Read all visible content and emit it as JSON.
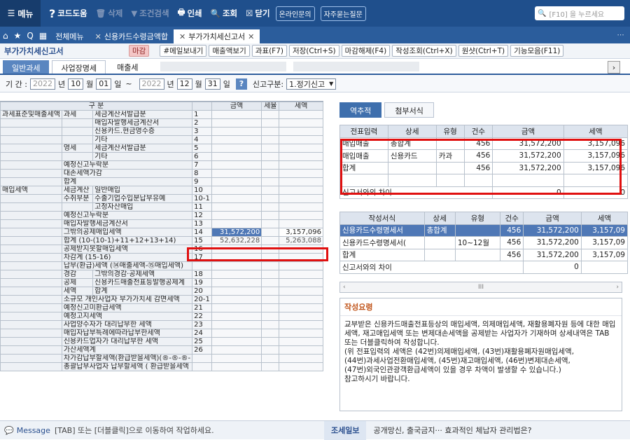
{
  "toolbar": {
    "menu": "메뉴",
    "help": "코드도움",
    "delete": "삭제",
    "condsearch": "조건검색",
    "print": "인쇄",
    "query": "조회",
    "close": "닫기",
    "online": "온라인문의",
    "faq": "자주묻는질문",
    "search_placeholder": "[F10] 을 누르세요"
  },
  "tabs": {
    "all": "전체메뉴",
    "t1": "신용카드수령금액합",
    "t2": "부가가치세신고서"
  },
  "page": {
    "title": "부가가치세신고서",
    "deadline": "마감",
    "buttons": [
      "#메일보내기",
      "매출액보기",
      "과표(F7)",
      "저장(Ctrl+S)",
      "마감해제(F4)",
      "작성조회(Ctrl+X)",
      "원샷(Ctrl+T)",
      "기능모음(F11)"
    ]
  },
  "subtabs": {
    "general": "일반과세",
    "biz": "사업장명세",
    "sales": "매출세"
  },
  "filter": {
    "period_label": "기 간 :",
    "y1": "2022",
    "y_unit": "년",
    "m1": "10",
    "m_unit": "월",
    "d1": "01",
    "d_unit": "일",
    "tilde": "~",
    "y2": "2022",
    "m2": "12",
    "d2": "31",
    "type_label": "신고구분:",
    "type_value": "1.정기신고"
  },
  "left": {
    "h_gubun": "구 분",
    "h_amt": "금액",
    "h_rate": "세율",
    "h_tax": "세액",
    "groups": {
      "g1": "과세표준및매출세액",
      "g2": "매입세액"
    },
    "rows": [
      {
        "a": "과세",
        "b": "세금계산서발급분",
        "no": "1"
      },
      {
        "a": "",
        "b": "매입자발행세금계산서",
        "no": "2"
      },
      {
        "a": "",
        "b": "신용카드.현금영수증",
        "no": "3"
      },
      {
        "a": "",
        "b": "기타",
        "no": "4"
      },
      {
        "a": "영세",
        "b": "세금계산서발급분",
        "no": "5"
      },
      {
        "a": "",
        "b": "기타",
        "no": "6"
      },
      {
        "a": "예정신고누락분",
        "b": "",
        "no": "7"
      },
      {
        "a": "대손세액가감",
        "b": "",
        "no": "8"
      },
      {
        "a": "합계",
        "b": "",
        "no": "9"
      },
      {
        "a": "세금계산",
        "b": "일반매입",
        "no": "10"
      },
      {
        "a": "수취부분",
        "b": "수출기업수입분납부유예",
        "no": "10-1"
      },
      {
        "a": "",
        "b": "고정자산매입",
        "no": "11"
      },
      {
        "a": "예정신고누락분",
        "b": "",
        "no": "12"
      },
      {
        "a": "매입자발행세금계산서",
        "b": "",
        "no": "13"
      },
      {
        "a": "그밖의공제매입세액",
        "b": "",
        "no": "14"
      },
      {
        "a": "합계 (10-(10-1)+11+12+13+14)",
        "b": "",
        "no": "15"
      },
      {
        "a": "공제받지못할매입세액",
        "b": "",
        "no": "16"
      },
      {
        "a": "차감계 (15-16)",
        "b": "",
        "no": "17"
      },
      {
        "a": "납부(환급)세액 (⑭매출세액-⑮매입세액)",
        "b": "",
        "no": ""
      },
      {
        "a": "경감",
        "b": "그밖의경감·공제세액",
        "no": "18"
      },
      {
        "a": "공제",
        "b": "신용카드매출전표등발행공제계",
        "no": "19"
      },
      {
        "a": "세액",
        "b": "합계",
        "no": "20"
      },
      {
        "a": "소규모 개인사업자 부가가치세 감면세액",
        "b": "",
        "no": "20-1"
      },
      {
        "a": "예정신고미환급세액",
        "b": "",
        "no": "21"
      },
      {
        "a": "예정고지세액",
        "b": "",
        "no": "22"
      },
      {
        "a": "사업양수자가 대리납부한 세액",
        "b": "",
        "no": "23"
      },
      {
        "a": "매입자납부특례에따라납부한세액",
        "b": "",
        "no": "24"
      },
      {
        "a": "신용카드업자가 대리납부한 세액",
        "b": "",
        "no": "25"
      },
      {
        "a": "가산세액계",
        "b": "",
        "no": "26"
      },
      {
        "a": "차가감납부할세액(환급받을세액)(®-®-®-",
        "b": "",
        "no": ""
      },
      {
        "a": "총괄납부사업자 납부할세액 ( 환급받을세액",
        "b": "",
        "no": ""
      }
    ],
    "row14_amt": "31,572,200",
    "row14_tax": "3,157,096",
    "row15_amt": "52,632,228",
    "row15_tax": "5,263,088"
  },
  "right": {
    "tab1": "역추적",
    "tab2": "첨부서식",
    "top": {
      "headers": [
        "전표입력",
        "상세",
        "유형",
        "건수",
        "금액",
        "세액"
      ],
      "rows": [
        [
          "매입매출",
          "총합계",
          "",
          "456",
          "31,572,200",
          "3,157,096"
        ],
        [
          "매입매출",
          "신용카드",
          "카과",
          "456",
          "31,572,200",
          "3,157,096"
        ],
        [
          "합계",
          "",
          "",
          "456",
          "31,572,200",
          "3,157,096"
        ],
        [
          "",
          "",
          "",
          "",
          "",
          ""
        ]
      ],
      "diff": [
        "신고서와의 차이",
        "0",
        "0"
      ]
    },
    "bottom": {
      "headers": [
        "작성서식",
        "상세",
        "유형",
        "건수",
        "금액",
        "세액"
      ],
      "rows": [
        [
          "신용카드수령명세서",
          "총합계",
          "",
          "456",
          "31,572,200",
          "3,157,09"
        ],
        [
          "신용카드수령명세서(",
          "",
          "10~12월",
          "456",
          "31,572,200",
          "3,157,09"
        ],
        [
          "합계",
          "",
          "",
          "456",
          "31,572,200",
          "3,157,09"
        ]
      ],
      "diff": [
        "신고서와의 차이",
        "0"
      ]
    },
    "scroll_mid": "III",
    "guide_title": "작성요령",
    "guide_text": "교부받은 신용카드매출전표등상의 매입세액, 의제매입세액, 재활용폐자원 등에 대한 매입세액, 재고매입세액 또는 변제대손세액을 공제받는 사업자가 기재하며 상세내역은 TAB 또는 더블클릭하여 작성합니다.\n(위 전표입력의 세액은 (42번)의제매입세액, (43번)재활용폐자원매입세액,\n(44번)과세사업전환매입세액, (45번)재고매입세액, (46번)변제대손세액,\n(47번)외국인관광객환급세액이 있을 경우 차액이 발생할 수 있습니다.)\n참고하시기 바랍니다."
  },
  "status": {
    "message_label": "Message",
    "message": "[TAB] 또는 [더블클릭]으로 이동하여 작업하세요.",
    "news_label": "조세일보",
    "news": "공개망신, 출국금지··· 효과적인 체납자 관리법은?"
  }
}
